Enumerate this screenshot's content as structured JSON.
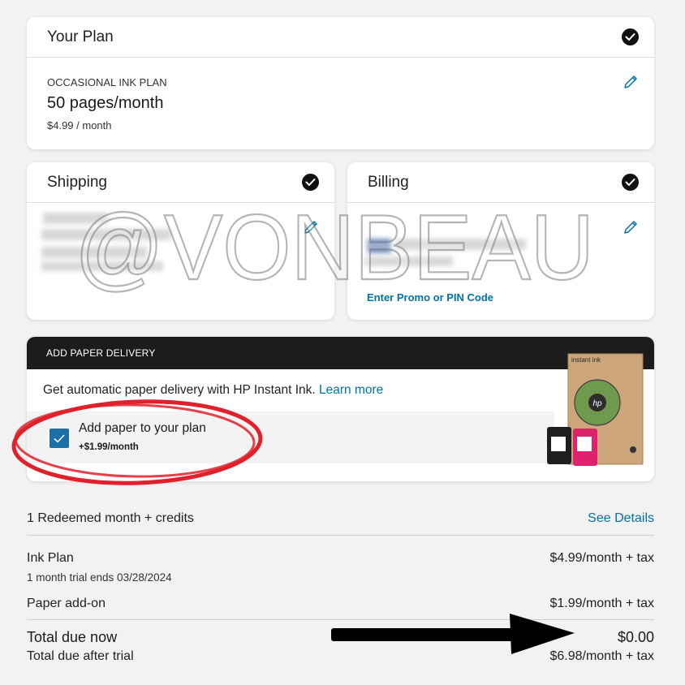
{
  "plan_card": {
    "title": "Your Plan",
    "plan_name": "OCCASIONAL INK PLAN",
    "pages": "50 pages/month",
    "price": "$4.99 / month"
  },
  "shipping_card": {
    "title": "Shipping"
  },
  "billing_card": {
    "title": "Billing",
    "promo_link": "Enter Promo or PIN Code"
  },
  "watermark": "@VONBEAU",
  "paper_card": {
    "header": "ADD PAPER DELIVERY",
    "description": "Get automatic paper delivery with HP Instant Ink.",
    "learn_more": "Learn more",
    "checkbox_label": "Add paper to your plan",
    "checkbox_price": "+$1.99/month",
    "checkbox_checked": true,
    "product_box_label": "instant ink",
    "product_logo": "hp"
  },
  "summary": {
    "redeemed": "1 Redeemed month + credits",
    "see_details": "See Details",
    "ink_plan_label": "Ink Plan",
    "ink_plan_price": "$4.99/month + tax",
    "trial_note": "1 month trial ends 03/28/2024",
    "paper_label": "Paper add-on",
    "paper_price": "$1.99/month + tax",
    "total_now_label": "Total due now",
    "total_now_value": "$0.00",
    "total_after_label": "Total due after trial",
    "total_after_value": "$6.98/month + tax"
  },
  "colors": {
    "accent_link": "#0073a8",
    "checkbox": "#1a6fa6",
    "dark_header": "#1c1c1c",
    "annotation_circle": "#e0202a"
  },
  "icons": [
    "checkmark-circle-icon",
    "pencil-icon",
    "checkbox-check-icon",
    "arrow-right-icon"
  ]
}
